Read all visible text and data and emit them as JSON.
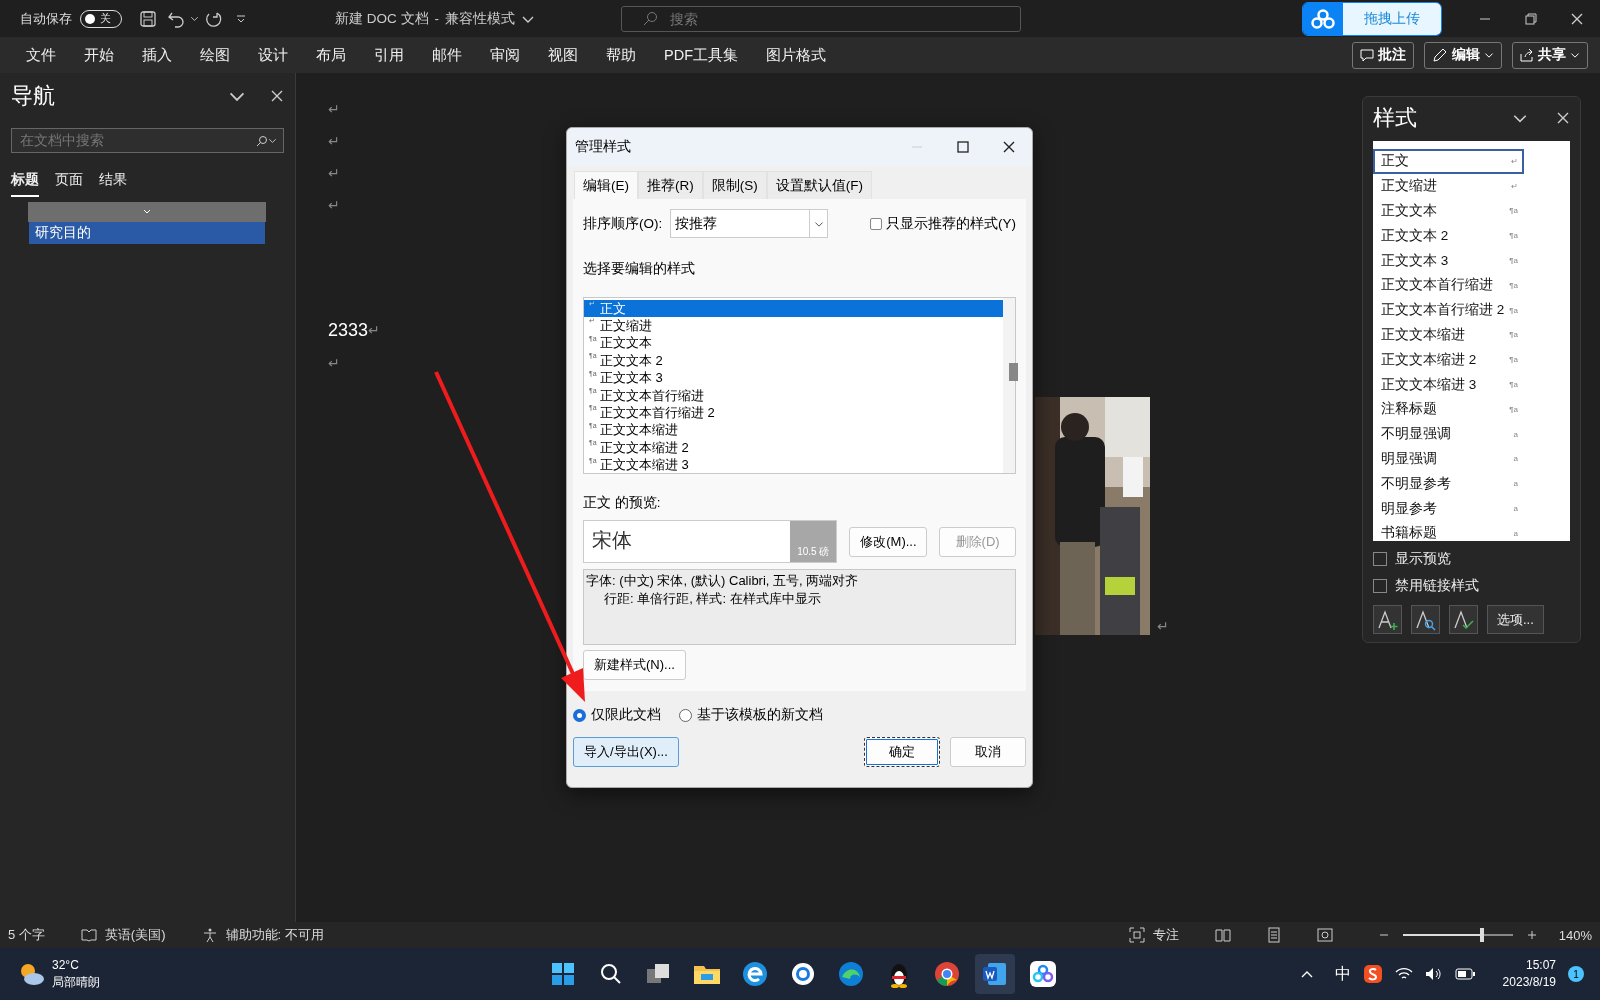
{
  "titlebar": {
    "autosave_label": "自动保存",
    "autosave": {
      "on": false,
      "label": "关"
    },
    "title": "新建 DOC 文档",
    "title_separator": "-",
    "mode": "兼容性模式",
    "search_placeholder": "搜索",
    "upload_button": "拖拽上传"
  },
  "menu": {
    "items": [
      "文件",
      "开始",
      "插入",
      "绘图",
      "设计",
      "布局",
      "引用",
      "邮件",
      "审阅",
      "视图",
      "帮助",
      "PDF工具集",
      "图片格式"
    ],
    "actions": [
      "批注",
      "编辑",
      "共享"
    ]
  },
  "nav": {
    "title": "导航",
    "search_placeholder": "在文档中搜索",
    "tabs": [
      {
        "label": "标题",
        "selected": true
      },
      {
        "label": "页面",
        "selected": false
      },
      {
        "label": "结果",
        "selected": false
      }
    ],
    "root_heading": {
      "expanded": true
    },
    "headings": [
      {
        "label": "研究目的",
        "selected": true
      }
    ]
  },
  "document": {
    "lines": [
      {
        "mark": "↵"
      },
      {
        "mark": "↵"
      },
      {
        "mark": "↵"
      },
      {
        "mark": "↵"
      },
      {
        "text": "2333",
        "mark": "↵"
      },
      {
        "mark": "↵"
      }
    ],
    "picture_mark": "↵"
  },
  "dialog": {
    "title": "管理样式",
    "tabs": [
      {
        "label": "编辑(E)",
        "selected": true
      },
      {
        "label": "推荐(R)",
        "selected": false
      },
      {
        "label": "限制(S)",
        "selected": false
      },
      {
        "label": "设置默认值(F)",
        "selected": false
      }
    ],
    "sort_label": "排序顺序(O):",
    "sort_value": "按推荐",
    "only_recommended": {
      "label": "只显示推荐的样式(Y)",
      "checked": false
    },
    "list_label": "选择要编辑的样式",
    "styles": [
      {
        "icon": "↵",
        "name": "正文",
        "selected": true
      },
      {
        "icon": "↵",
        "name": "正文缩进",
        "selected": false
      },
      {
        "icon": "¶a",
        "name": "正文文本",
        "selected": false
      },
      {
        "icon": "¶a",
        "name": "正文文本 2",
        "selected": false
      },
      {
        "icon": "¶a",
        "name": "正文文本 3",
        "selected": false
      },
      {
        "icon": "¶a",
        "name": "正文文本首行缩进",
        "selected": false
      },
      {
        "icon": "¶a",
        "name": "正文文本首行缩进 2",
        "selected": false
      },
      {
        "icon": "¶a",
        "name": "正文文本缩进",
        "selected": false
      },
      {
        "icon": "¶a",
        "name": "正文文本缩进 2",
        "selected": false
      },
      {
        "icon": "¶a",
        "name": "正文文本缩进 3",
        "selected": false
      }
    ],
    "preview_label": "正文 的预览:",
    "preview_text": "宋体",
    "preview_size": "10.5 磅",
    "modify_button": {
      "label": "修改(M)...",
      "disabled": false
    },
    "delete_button": {
      "label": "删除(D)",
      "disabled": true
    },
    "description": [
      "字体: (中文) 宋体, (默认) Calibri, 五号, 两端对齐",
      "行距: 单倍行距, 样式: 在样式库中显示"
    ],
    "new_style_button": "新建样式(N)...",
    "scope": [
      {
        "label": "仅限此文档",
        "selected": true
      },
      {
        "label": "基于该模板的新文档",
        "selected": false
      }
    ],
    "buttons": [
      {
        "label": "导入/导出(X)...",
        "kind": "focus"
      },
      {
        "label": "确定",
        "kind": "default"
      },
      {
        "label": "取消",
        "kind": "plain"
      }
    ]
  },
  "styles_pane": {
    "title": "样式",
    "items": [
      {
        "name": "正文",
        "icon": "↵",
        "selected": true
      },
      {
        "name": "正文缩进",
        "icon": "↵",
        "selected": false
      },
      {
        "name": "正文文本",
        "icon": "¶a",
        "selected": false
      },
      {
        "name": "正文文本 2",
        "icon": "¶a",
        "selected": false
      },
      {
        "name": "正文文本 3",
        "icon": "¶a",
        "selected": false
      },
      {
        "name": "正文文本首行缩进",
        "icon": "¶a",
        "selected": false
      },
      {
        "name": "正文文本首行缩进 2",
        "icon": "¶a",
        "selected": false
      },
      {
        "name": "正文文本缩进",
        "icon": "¶a",
        "selected": false
      },
      {
        "name": "正文文本缩进 2",
        "icon": "¶a",
        "selected": false
      },
      {
        "name": "正文文本缩进 3",
        "icon": "¶a",
        "selected": false
      },
      {
        "name": "注释标题",
        "icon": "¶a",
        "selected": false
      },
      {
        "name": "不明显强调",
        "icon": "a",
        "selected": false
      },
      {
        "name": "明显强调",
        "icon": "a",
        "selected": false
      },
      {
        "name": "不明显参考",
        "icon": "a",
        "selected": false
      },
      {
        "name": "明显参考",
        "icon": "a",
        "selected": false
      },
      {
        "name": "书籍标题",
        "icon": "a",
        "selected": false
      }
    ],
    "options": [
      {
        "label": "显示预览",
        "checked": false
      },
      {
        "label": "禁用链接样式",
        "checked": false
      }
    ],
    "options_button": "选项..."
  },
  "status_bar": {
    "word_count": "5 个字",
    "language": "英语(美国)",
    "accessibility": "辅助功能: 不可用",
    "focus": "专注",
    "zoom": {
      "level": 0.72,
      "reading": "140%"
    }
  },
  "taskbar": {
    "temperature": "32°C",
    "weather": "局部晴朗",
    "ime": "中",
    "time": "15:07",
    "date": "2023/8/19",
    "notifications": "1"
  }
}
